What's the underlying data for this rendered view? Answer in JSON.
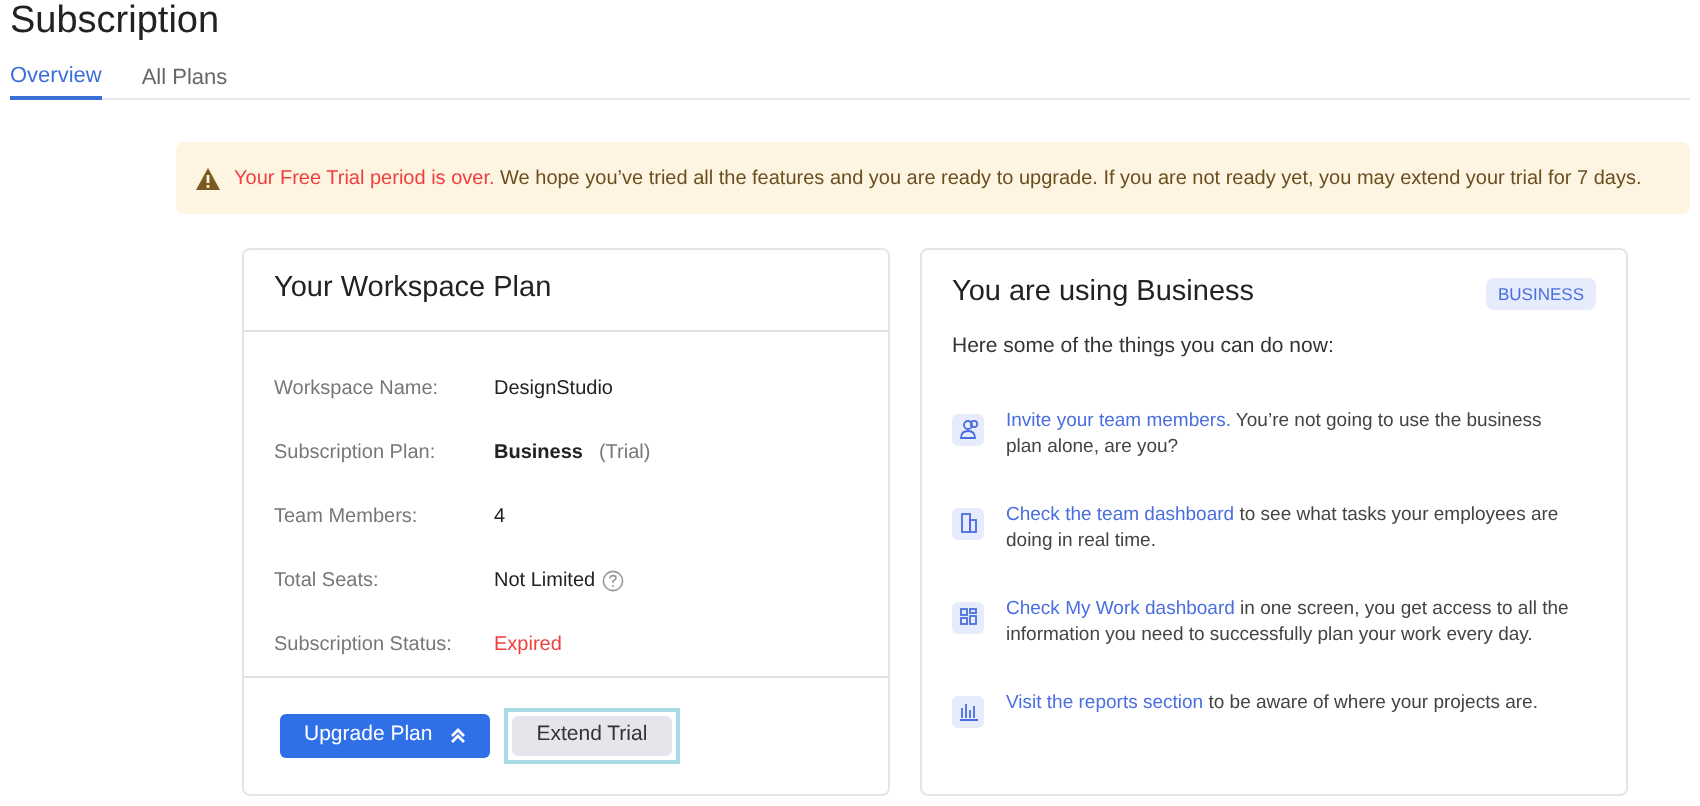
{
  "page": {
    "title": "Subscription"
  },
  "tabs": [
    {
      "label": "Overview",
      "selected": true
    },
    {
      "label": "All Plans",
      "selected": false
    }
  ],
  "alert": {
    "highlight": "Your Free Trial period is over.",
    "text": " We hope you’ve tried all the features and you are ready to upgrade. If you are not ready yet, you may extend your trial for 7 days."
  },
  "plan_card": {
    "title": "Your Workspace Plan",
    "rows": [
      {
        "kind": "plain",
        "label": "Workspace Name:",
        "value": "DesignStudio"
      },
      {
        "kind": "plan",
        "label": "Subscription Plan:",
        "value": "Business",
        "note": "(Trial)"
      },
      {
        "kind": "plain",
        "label": "Team Members:",
        "value": "4"
      },
      {
        "kind": "help",
        "label": "Total Seats:",
        "value": "Not Limited"
      },
      {
        "kind": "status",
        "label": "Subscription Status:",
        "value": "Expired"
      }
    ],
    "buttons": [
      {
        "kind": "primary",
        "label": "Upgrade Plan",
        "focused": false
      },
      {
        "kind": "secondary",
        "label": "Extend Trial",
        "focused": true
      }
    ]
  },
  "business_card": {
    "title": "You are using Business",
    "badge": "BUSINESS",
    "intro": "Here some of the things you can do now:",
    "items": [
      {
        "kind": "team",
        "link": "Invite your team members.",
        "text": " You’re not going to use the business plan alone, are you?"
      },
      {
        "kind": "dashboard",
        "link": "Check the team dashboard",
        "text": " to see what tasks your employees are doing in real time."
      },
      {
        "kind": "grid",
        "link": "Check My Work dashboard",
        "text": " in one screen, you get access to all the information you need to successfully plan your work every day."
      },
      {
        "kind": "reports",
        "link": "Visit the reports section",
        "text": " to be aware of where your projects are."
      }
    ]
  }
}
